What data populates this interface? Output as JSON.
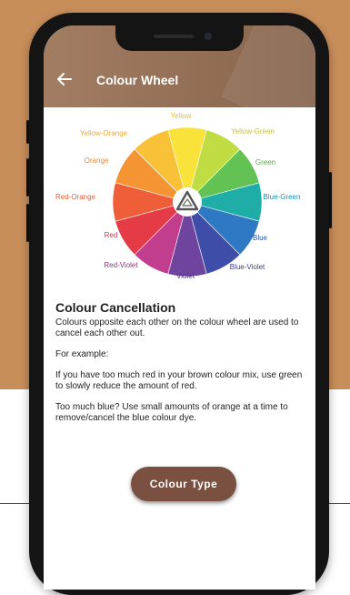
{
  "header": {
    "title": "Colour Wheel",
    "back_icon": "arrow-left-icon",
    "background": "#96725a"
  },
  "wheel": {
    "center_icon": "triangle-logo-icon",
    "segments": [
      {
        "label": "Yellow",
        "color": "#f9e23a",
        "label_color": "#e9c020"
      },
      {
        "label": "Yellow-Green",
        "color": "#bfdc42",
        "label_color": "#c9c04a"
      },
      {
        "label": "Green",
        "color": "#63c254",
        "label_color": "#5aa84c"
      },
      {
        "label": "Blue-Green",
        "color": "#1faea7",
        "label_color": "#1b8fb5"
      },
      {
        "label": "Blue",
        "color": "#2f78c3",
        "label_color": "#2656a8"
      },
      {
        "label": "Blue-Violet",
        "color": "#3d4da8",
        "label_color": "#3b3b92"
      },
      {
        "label": "Violet",
        "color": "#6e449f",
        "label_color": "#5b3490"
      },
      {
        "label": "Red-Violet",
        "color": "#c13e8f",
        "label_color": "#9a2f88"
      },
      {
        "label": "Red",
        "color": "#e53b46",
        "label_color": "#d23549"
      },
      {
        "label": "Red-Orange",
        "color": "#ee5e39",
        "label_color": "#e25e3c"
      },
      {
        "label": "Orange",
        "color": "#f59433",
        "label_color": "#e48a3a"
      },
      {
        "label": "Yellow-Orange",
        "color": "#f8c137",
        "label_color": "#e5ad3c"
      }
    ]
  },
  "content": {
    "heading": "Colour Cancellation",
    "p1": "Colours opposite each other on the colour wheel are used to cancel each other out.",
    "p2": "For example:",
    "p3": "If you have too much red in your brown colour mix, use green to slowly reduce the amount of red.",
    "p4": "Too much blue? Use small amounts of orange at a time to remove/cancel the blue colour dye."
  },
  "button": {
    "label": "Colour Type",
    "color": "#7a5140"
  },
  "colors": {
    "backdrop": "#c88e5a"
  }
}
